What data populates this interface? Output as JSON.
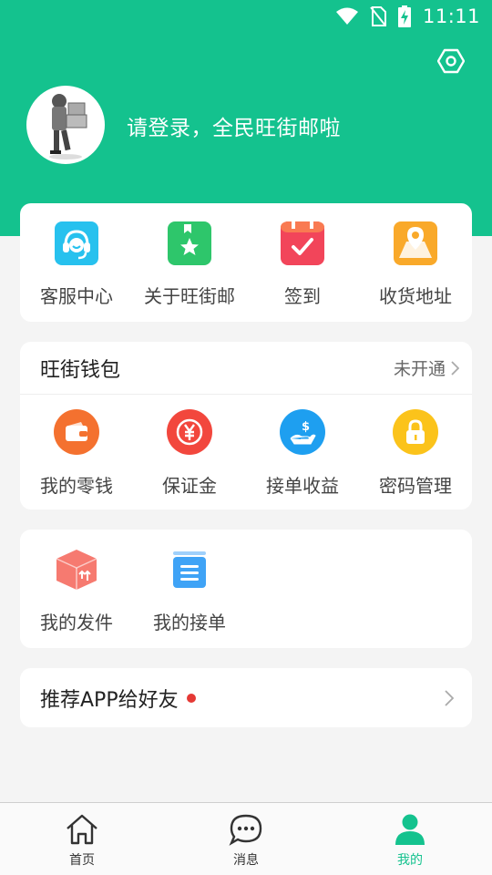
{
  "status_bar": {
    "time": "11:11"
  },
  "header": {
    "login_prompt": "请登录，全民旺街邮啦"
  },
  "quick_actions": [
    {
      "label": "客服中心",
      "icon": "headset-icon"
    },
    {
      "label": "关于旺街邮",
      "icon": "bookmark-star-icon"
    },
    {
      "label": "签到",
      "icon": "calendar-check-icon"
    },
    {
      "label": "收货地址",
      "icon": "map-pin-icon"
    }
  ],
  "wallet": {
    "title": "旺街钱包",
    "status": "未开通",
    "items": [
      {
        "label": "我的零钱",
        "icon": "wallet-icon"
      },
      {
        "label": "保证金",
        "icon": "yuan-icon"
      },
      {
        "label": "接单收益",
        "icon": "hand-coin-icon"
      },
      {
        "label": "密码管理",
        "icon": "lock-icon"
      }
    ]
  },
  "orders": [
    {
      "label": "我的发件",
      "icon": "package-icon"
    },
    {
      "label": "我的接单",
      "icon": "order-list-icon"
    }
  ],
  "recommend": {
    "label": "推荐APP给好友"
  },
  "tabs": [
    {
      "label": "首页",
      "icon": "home-icon"
    },
    {
      "label": "消息",
      "icon": "chat-icon"
    },
    {
      "label": "我的",
      "icon": "user-icon"
    }
  ],
  "colors": {
    "brand": "#14c28e",
    "badge": "#e53935"
  }
}
